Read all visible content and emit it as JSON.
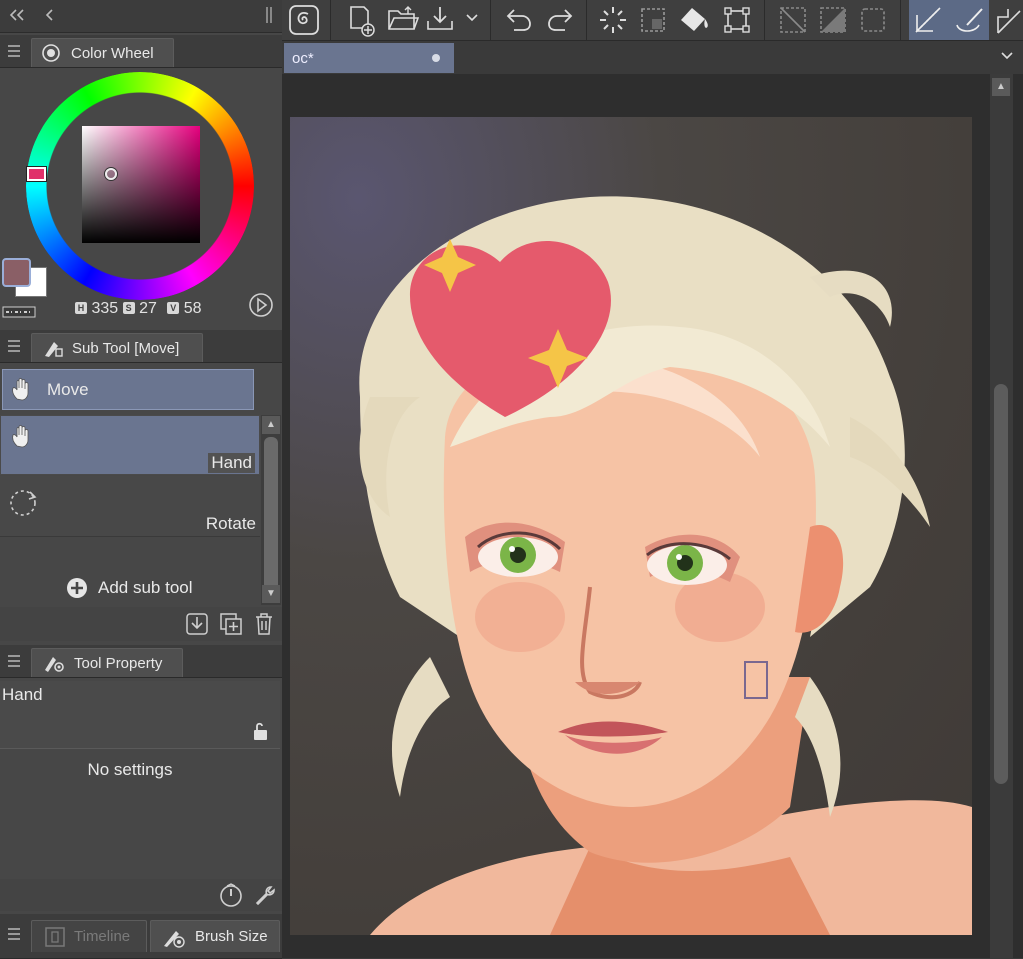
{
  "colors": {
    "accent": "#6b7a9a",
    "panel": "#474747",
    "selected_row": "#6a7590"
  },
  "color_wheel": {
    "tab_label": "Color Wheel",
    "hsv": {
      "h_label": "H",
      "h": "335",
      "s_label": "S",
      "s": "27",
      "v_label": "V",
      "v": "58"
    },
    "main_color": "#8a5f66",
    "sub_color": "#ffffff"
  },
  "sub_tool": {
    "tab_label": "Sub Tool [Move]",
    "group_label": "Move",
    "items": [
      {
        "label": "Hand",
        "icon": "hand-icon",
        "selected": true
      },
      {
        "label": "Rotate",
        "icon": "rotate-icon",
        "selected": false
      }
    ],
    "add_label": "Add sub tool"
  },
  "tool_property": {
    "tab_label": "Tool Property",
    "tool_name": "Hand",
    "empty_message": "No settings"
  },
  "bottom_tabs": [
    {
      "label": "Timeline"
    },
    {
      "label": "Brush Size"
    }
  ],
  "document": {
    "tab_label": "oc*"
  }
}
